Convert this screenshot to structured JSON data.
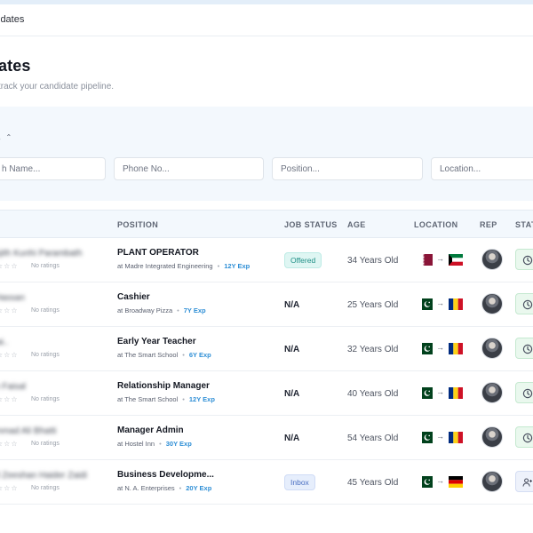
{
  "breadcrumb": {
    "text": "idates"
  },
  "header": {
    "title": "ates",
    "subtitle": "track your candidate pipeline."
  },
  "filters": {
    "toggle_label": "s",
    "name_placeholder": "h Name...",
    "phone_placeholder": "Phone No...",
    "position_placeholder": "Position...",
    "location_placeholder": "Location..."
  },
  "table": {
    "columns": {
      "position": "POSITION",
      "job_status": "JOB STATUS",
      "age": "AGE",
      "location": "LOCATION",
      "rep": "REP",
      "status": "STAT"
    },
    "rows": [
      {
        "name": "njith Kunhi Parambath",
        "stars": "☆☆☆",
        "ratings": "No ratings",
        "position": "PLANT OPERATOR",
        "company": "at Madre Integrated Engineering",
        "exp": "12Y Exp",
        "job_status": "Offered",
        "age": "34 Years Old",
        "from_flag": "qatar",
        "to_flag": "kuwait",
        "arrow": "→",
        "action": "clock"
      },
      {
        "name": "Hassan",
        "stars": "☆☆☆",
        "ratings": "No ratings",
        "position": "Cashier",
        "company": "at Broadway Pizza",
        "exp": "7Y Exp",
        "job_status": "N/A",
        "age": "25 Years Old",
        "from_flag": "pakistan",
        "to_flag": "romania",
        "arrow": "→",
        "action": "clock"
      },
      {
        "name": "iai..",
        "stars": "☆☆☆",
        "ratings": "No ratings",
        "position": "Early Year Teacher",
        "company": "at The Smart School",
        "exp": "6Y Exp",
        "job_status": "N/A",
        "age": "32 Years Old",
        "from_flag": "pakistan",
        "to_flag": "romania",
        "arrow": "→",
        "action": "clock"
      },
      {
        "name": "h Faisal",
        "stars": "☆☆☆",
        "ratings": "No ratings",
        "position": "Relationship Manager",
        "company": "at The Smart School",
        "exp": "12Y Exp",
        "job_status": "N/A",
        "age": "40 Years Old",
        "from_flag": "pakistan",
        "to_flag": "romania",
        "arrow": "→",
        "action": "clock"
      },
      {
        "name": "mmad Ali Bhatti",
        "stars": "☆☆☆",
        "ratings": "No ratings",
        "position": "Manager Admin",
        "company": "at Hostel Inn",
        "exp": "30Y Exp",
        "job_status": "N/A",
        "age": "54 Years Old",
        "from_flag": "pakistan",
        "to_flag": "romania",
        "arrow": "→",
        "action": "clock"
      },
      {
        "name": "d Zeeshan Haider Zaidi",
        "stars": "☆☆☆",
        "ratings": "No ratings",
        "position": "Business Developme...",
        "company": "at N. A. Enterprises",
        "exp": "20Y Exp",
        "job_status": "Inbox",
        "age": "45 Years Old",
        "from_flag": "pakistan",
        "to_flag": "germany",
        "arrow": "→",
        "action": "user-add"
      }
    ]
  },
  "colors": {
    "accent_blue": "#2f8fd6",
    "panel_bg": "#f3f8fd",
    "offered_text": "#1f8f86",
    "inbox_text": "#4a6fc2",
    "action_green": "#eaf8ee"
  }
}
